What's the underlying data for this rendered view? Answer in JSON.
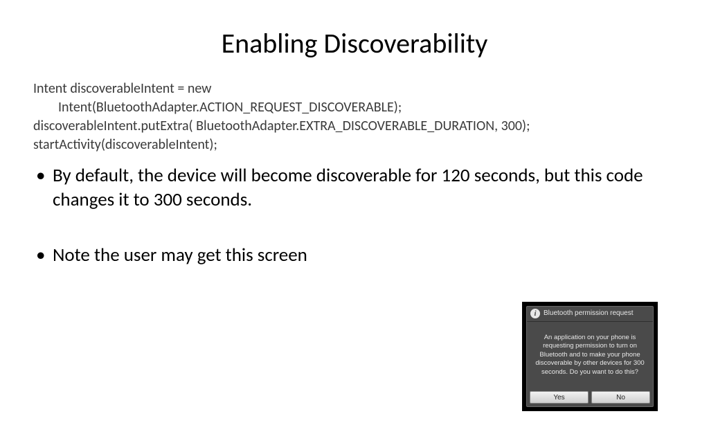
{
  "title": "Enabling Discoverability",
  "code": {
    "line1a": "Intent discoverableIntent = new",
    "line1b": "Intent(BluetoothAdapter.ACTION_REQUEST_DISCOVERABLE);",
    "line2": "discoverableIntent.putExtra( BluetoothAdapter.EXTRA_DISCOVERABLE_DURATION, 300);",
    "line3": "startActivity(discoverableIntent);"
  },
  "bullets": {
    "b1": "By default, the device will become discoverable for 120 seconds, but this code changes it to 300 seconds.",
    "b2": "Note the user may get this screen"
  },
  "dialog": {
    "icon_glyph": "i",
    "title": "Bluetooth permission request",
    "body": "An application on your phone is requesting permission to turn on Bluetooth and to make your phone discoverable by other devices for 300 seconds. Do you want to do this?",
    "yes": "Yes",
    "no": "No"
  }
}
